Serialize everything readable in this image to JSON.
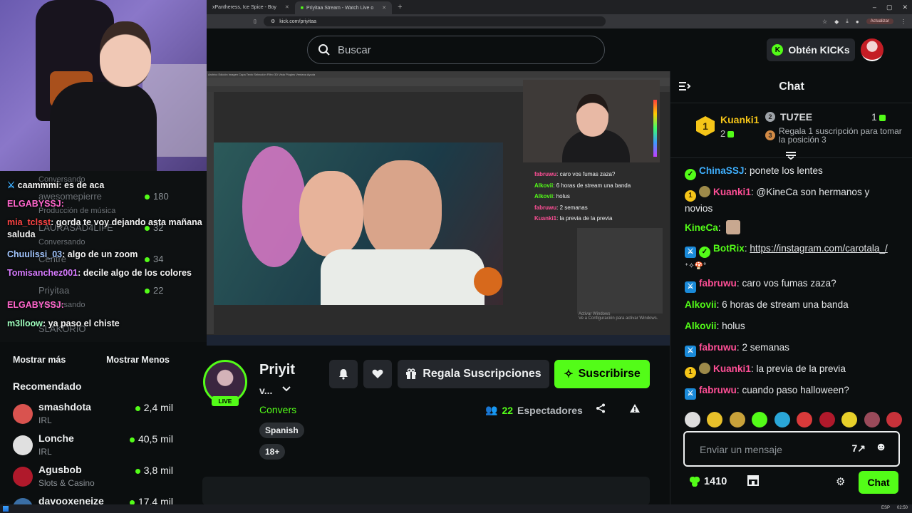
{
  "browser": {
    "tabs": [
      {
        "title": "xPantheress, Ice Spice - Boy"
      },
      {
        "title": "Priyitaa Stream - Watch Live o"
      }
    ],
    "url": "kick.com/priyitaa",
    "update_label": "Actualizar"
  },
  "topnav": {
    "search_placeholder": "Buscar",
    "kicks_label": "Obtén KICKs"
  },
  "stream_overlay": {
    "chat": [
      {
        "user": "fabruwu",
        "text": "caro vos fumas zaza?",
        "color": "#ff4f96"
      },
      {
        "user": "Alkovii",
        "text": "6 horas de stream una banda",
        "color": "#53fc18"
      },
      {
        "user": "Alkovii",
        "text": "holus",
        "color": "#53fc18"
      },
      {
        "user": "fabruwu",
        "text": "2 semanas",
        "color": "#ff4f96"
      },
      {
        "user": "Kuanki1",
        "text": "la previa de la previa",
        "color": "#ff4f96"
      }
    ],
    "activate": "Activar Windows",
    "activate_sub": "Ve a Configuración para activar Windows."
  },
  "left_overlay": {
    "chat": [
      {
        "user": "caammmi",
        "text": "es de aca",
        "color": "#ffffff"
      },
      {
        "user": "ELGABYSSJ",
        "text": "",
        "color": "#ff66cc"
      },
      {
        "user": "mia_tclsst",
        "text": "gorda te voy dejando asta mañana saluda",
        "color": "#ff4444"
      },
      {
        "user": "Chuulissi_03",
        "text": "algo de un zoom",
        "color": "#a2c6ff"
      },
      {
        "user": "Tomisanchez001",
        "text": "decile algo de los colores",
        "color": "#d77bff"
      },
      {
        "user": "ELGABYSSJ",
        "text": "",
        "color": "#ff66cc"
      },
      {
        "user": "m3lloow",
        "text": "ya paso el chiste",
        "color": "#9fffbf"
      }
    ],
    "ghost_rows": [
      {
        "name": "Conversando",
        "count": ""
      },
      {
        "name": "awesomepierre",
        "count": "180"
      },
      {
        "name": "Producción de música",
        "count": ""
      },
      {
        "name": "LAURASAD4LIFE",
        "count": "32"
      },
      {
        "name": "Conversando",
        "count": ""
      },
      {
        "name": "Centre",
        "count": "34"
      },
      {
        "name": "Priyitaa",
        "count": "22"
      },
      {
        "name": "Conversando",
        "count": ""
      },
      {
        "name": "SLAKORIO",
        "count": ""
      }
    ]
  },
  "sidebar": {
    "show_more": "Mostrar más",
    "show_less": "Mostrar Menos",
    "recommended_title": "Recomendado",
    "recommended": [
      {
        "name": "smashdota",
        "category": "IRL",
        "viewers": "2,4 mil",
        "color": "#d9534f"
      },
      {
        "name": "Lonche",
        "category": "IRL",
        "viewers": "40,5 mil",
        "color": "#e0e0e0"
      },
      {
        "name": "Agusbob",
        "category": "Slots & Casino",
        "viewers": "3,8 mil",
        "color": "#b0192b"
      },
      {
        "name": "davooxeneize",
        "category": "",
        "viewers": "17,4 mil",
        "color": "#3a6ea5"
      }
    ]
  },
  "channel": {
    "name": "Priyit",
    "title": "v...",
    "category": "Convers",
    "tags": [
      "Spanish",
      "18+"
    ],
    "live_label": "LIVE",
    "gift_label": "Regala Suscripciones",
    "subscribe_label": "Suscribirse",
    "viewers_count": "22",
    "viewers_label": "Espectadores"
  },
  "chat": {
    "title": "Chat",
    "leaderboard": {
      "first": {
        "name": "Kuanki1",
        "count": "2"
      },
      "second": {
        "name": "TU7EE",
        "count": "1"
      },
      "third_text": "Regala 1 suscripción para tomar la posición 3"
    },
    "messages": [
      {
        "user": "ChinaSSJ",
        "text": "ponete los lentes",
        "color": "#3fb0ff",
        "badges": [
          "verified"
        ]
      },
      {
        "user": "Kuanki1",
        "text": "@KineCa son hermanos y novios",
        "color": "#ff4f96",
        "badges": [
          "gold",
          "emo"
        ]
      },
      {
        "user": "KineCa",
        "text": "",
        "color": "#53fc18",
        "badges": []
      },
      {
        "user": "BotRix",
        "text": "https://instagram.com/carotala_/",
        "color": "#53fc18",
        "badges": [
          "sword",
          "verified"
        ]
      },
      {
        "user": "fabruwu",
        "text": "caro vos fumas zaza?",
        "color": "#ff4f96",
        "badges": [
          "sword"
        ]
      },
      {
        "user": "Alkovii",
        "text": "6 horas de stream una banda",
        "color": "#53fc18",
        "badges": []
      },
      {
        "user": "Alkovii",
        "text": "holus",
        "color": "#53fc18",
        "badges": []
      },
      {
        "user": "fabruwu",
        "text": "2 semanas",
        "color": "#ff4f96",
        "badges": [
          "sword"
        ]
      },
      {
        "user": "Kuanki1",
        "text": "la previa de la previa",
        "color": "#ff4f96",
        "badges": [
          "gold",
          "emo"
        ]
      },
      {
        "user": "fabruwu",
        "text": "cuando paso halloween?",
        "color": "#ff4f96",
        "badges": [
          "sword"
        ]
      }
    ],
    "input_placeholder": "Enviar un mensaje",
    "kicks_balance": "1410",
    "send_label": "Chat"
  },
  "taskbar": {
    "lang": "ESP",
    "time": "02:50"
  }
}
